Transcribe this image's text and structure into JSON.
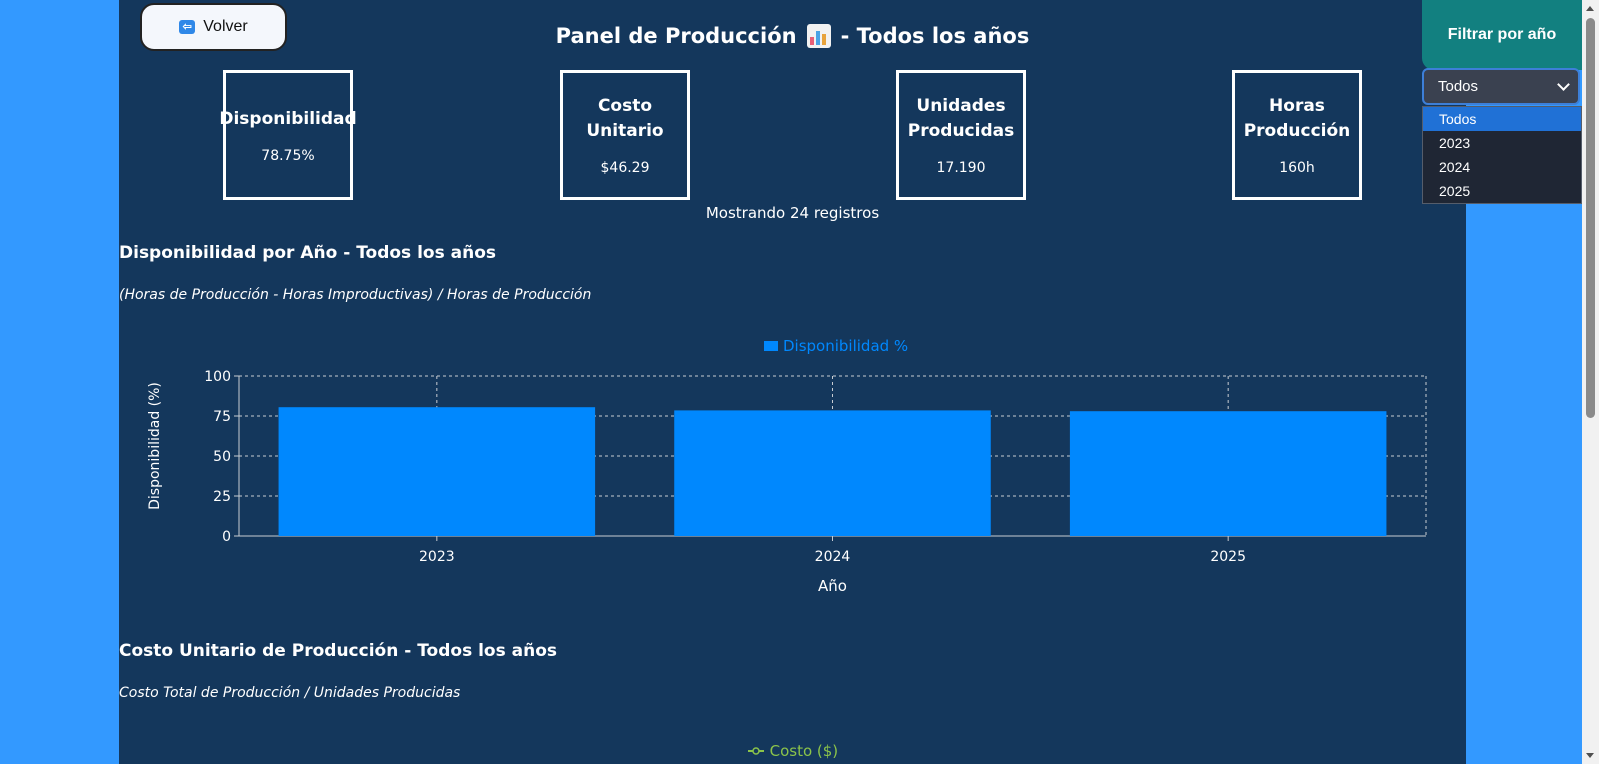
{
  "header": {
    "back_label": "Volver",
    "title": "Panel de Producción",
    "title_suffix": "- Todos los años"
  },
  "cards": [
    {
      "title": "Disponibilidad",
      "value": "78.75%"
    },
    {
      "title": "Costo Unitario",
      "value": "$46.29"
    },
    {
      "title": "Unidades Producidas",
      "value": "17.190"
    },
    {
      "title": "Horas Producción",
      "value": "160h"
    }
  ],
  "records_text": "Mostrando 24 registros",
  "section1": {
    "title": "Disponibilidad por Año - Todos los años",
    "formula": "(Horas de Producción - Horas Improductivas) / Horas de Producción"
  },
  "chart_data": {
    "type": "bar",
    "categories": [
      "2023",
      "2024",
      "2025"
    ],
    "series": [
      {
        "name": "Disponibilidad %",
        "values": [
          80.5,
          78.5,
          78.0
        ]
      }
    ],
    "xlabel": "Año",
    "ylabel": "Disponibilidad (%)",
    "ylim": [
      0,
      100
    ],
    "yticks": [
      0,
      25,
      50,
      75,
      100
    ],
    "grid": true,
    "legend_position": "top-center",
    "bar_color": "#0088fe"
  },
  "section2": {
    "title": "Costo Unitario de Producción - Todos los años",
    "formula": "Costo Total de Producción / Unidades Producidas",
    "legend": "Costo ($)",
    "legend_color": "#8bc34a"
  },
  "filter": {
    "title": "Filtrar por año",
    "selected": "Todos",
    "options": [
      "Todos",
      "2023",
      "2024",
      "2025"
    ]
  },
  "colors": {
    "page_bg": "#3399ff",
    "panel_bg": "#14375c",
    "filter_bg": "#128080"
  },
  "icons": {
    "back": "back-arrow-icon",
    "title": "bar-chart-emoji-icon"
  }
}
